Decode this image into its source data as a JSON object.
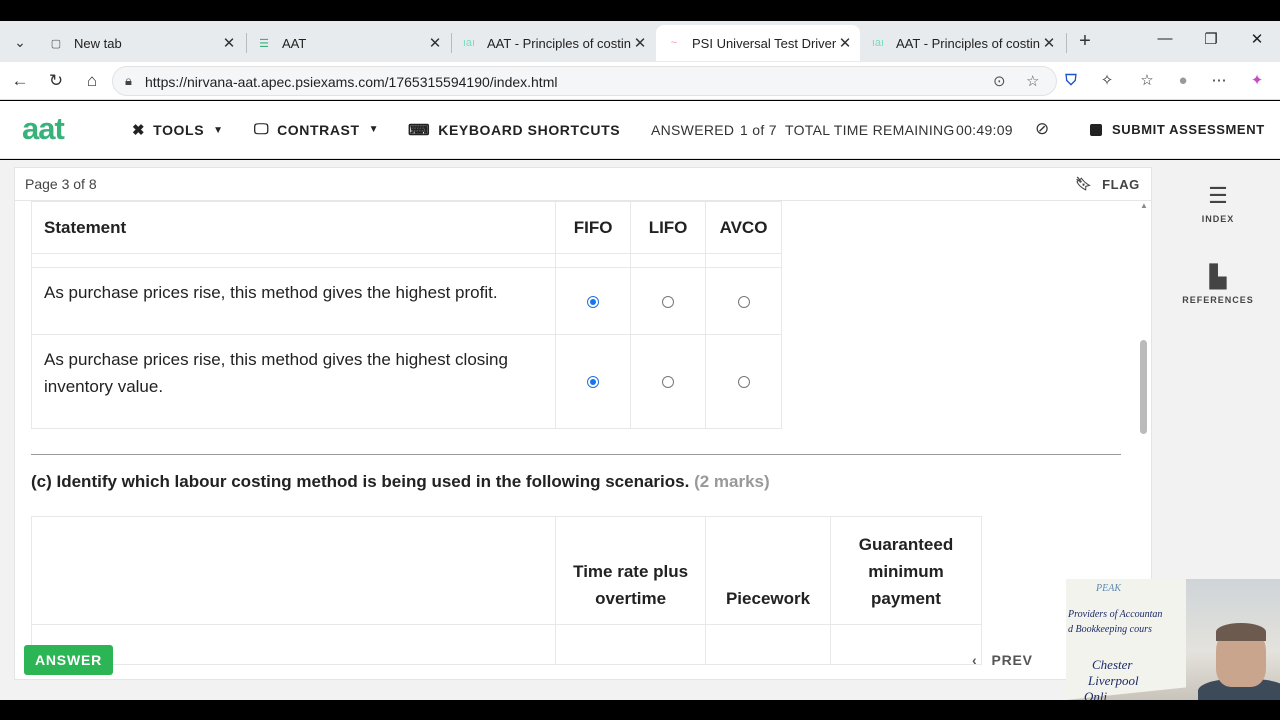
{
  "browser": {
    "tabs": [
      {
        "title": "New tab",
        "favicon": "newtab-icon"
      },
      {
        "title": "AAT",
        "favicon": "aat-icon"
      },
      {
        "title": "AAT - Principles of costing -",
        "favicon": "aat-icon"
      },
      {
        "title": "PSI Universal Test Driver",
        "favicon": "psi-icon",
        "active": true
      },
      {
        "title": "AAT - Principles of costing -",
        "favicon": "aat-icon"
      }
    ],
    "url": "https://nirvana-aat.apec.psiexams.com/1765315594190/index.html"
  },
  "header": {
    "logo": "aat",
    "tools_label": "TOOLS",
    "contrast_label": "CONTRAST",
    "shortcuts_label": "KEYBOARD SHORTCUTS",
    "answered_label": "ANSWERED",
    "answered_value": "1 of 7",
    "time_label": "TOTAL TIME REMAINING",
    "time_value": "00:49:09",
    "submit_label": "SUBMIT ASSESSMENT"
  },
  "page": {
    "page_number": "Page 3 of 8",
    "flag_label": "FLAG"
  },
  "table1": {
    "headers": [
      "Statement",
      "FIFO",
      "LIFO",
      "AVCO"
    ],
    "rows": [
      {
        "statement": "As purchase prices rise, this method gives the highest profit.",
        "selected": "FIFO"
      },
      {
        "statement": "As purchase prices rise, this method gives the highest closing inventory value.",
        "selected": "FIFO"
      }
    ]
  },
  "question_c": {
    "text": "(c) Identify which labour costing method is being used in the following scenarios.",
    "marks": "(2 marks)",
    "headers": [
      "",
      "Time rate plus overtime",
      "Piecework",
      "Guaranteed minimum payment"
    ]
  },
  "sidebar": {
    "index_label": "INDEX",
    "references_label": "REFERENCES"
  },
  "footer": {
    "answer_label": "ANSWER",
    "prev_label": "PREV"
  },
  "webcam": {
    "poster_lines": [
      "PEAK",
      "Providers of Accountan",
      "d Bookkeeping cours",
      "Chester",
      "Liverpool",
      "Onli"
    ]
  },
  "colors": {
    "brand_green": "#36b27a",
    "answer_green": "#2cb554",
    "radio_blue": "#1a73e8"
  }
}
